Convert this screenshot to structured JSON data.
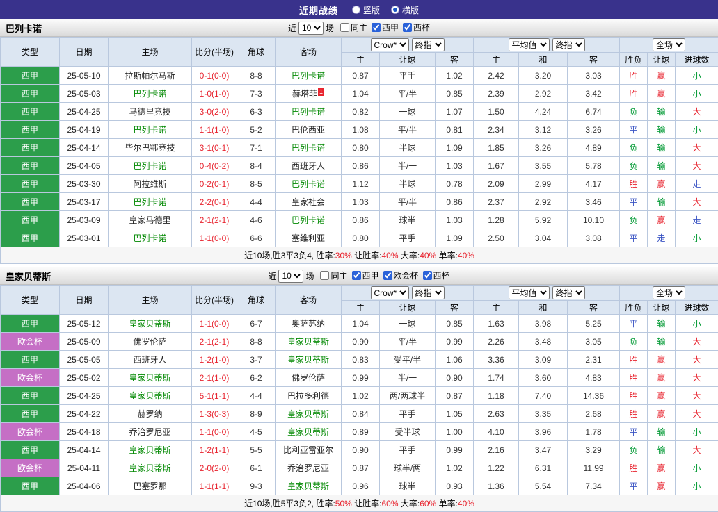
{
  "topbar": {
    "title": "近期战绩",
    "radios": [
      {
        "label": "竖版",
        "checked": false
      },
      {
        "label": "横版",
        "checked": true
      }
    ]
  },
  "table_header": {
    "type": "类型",
    "date": "日期",
    "home": "主场",
    "score": "比分(半场)",
    "corner": "角球",
    "away": "客场",
    "odds_cols": {
      "home": "主",
      "handicap": "让球",
      "away": "客"
    },
    "avg_cols": {
      "home": "主",
      "draw": "和",
      "away": "客"
    },
    "result_cols": {
      "wdl": "胜负",
      "handicap": "让球",
      "goals": "进球数"
    }
  },
  "colors": {
    "topbar_bg": "#39328c",
    "league_liga_green": "#2c9e4b",
    "league_cup_purple": "#c56fc5",
    "win_red": "#e8242f",
    "lose_green": "#009933",
    "draw_blue": "#3b55c4",
    "focus_team_green": "#008800",
    "table_header_bg": "#dce6f2"
  },
  "sections": [
    {
      "team": "巴列卡诺",
      "filters": {
        "near": "近",
        "count": "10",
        "games": "场",
        "checkboxes": [
          {
            "label": "同主",
            "checked": false
          },
          {
            "label": "西甲",
            "checked": true
          },
          {
            "label": "西杯",
            "checked": true
          }
        ]
      },
      "selects": {
        "company": "Crow*",
        "final1": "终指",
        "average": "平均值",
        "final2": "终指",
        "scope": "全场"
      },
      "rows": [
        {
          "league": "西甲",
          "cup": false,
          "date": "25-05-10",
          "home": "拉斯帕尔马斯",
          "home_focus": false,
          "score": "0-1(0-0)",
          "corner": "8-8",
          "away": "巴列卡诺",
          "away_focus": true,
          "odds": [
            "0.87",
            "平手",
            "1.02"
          ],
          "avg": [
            "2.42",
            "3.20",
            "3.03"
          ],
          "result": [
            {
              "t": "胜",
              "c": "red"
            },
            {
              "t": "赢",
              "c": "red"
            },
            {
              "t": "小",
              "c": "green"
            }
          ]
        },
        {
          "league": "西甲",
          "cup": false,
          "date": "25-05-03",
          "home": "巴列卡诺",
          "home_focus": true,
          "score": "1-0(1-0)",
          "corner": "7-3",
          "away": "赫塔菲",
          "away_focus": false,
          "away_badge": "1",
          "odds": [
            "1.04",
            "平/半",
            "0.85"
          ],
          "avg": [
            "2.39",
            "2.92",
            "3.42"
          ],
          "result": [
            {
              "t": "胜",
              "c": "red"
            },
            {
              "t": "赢",
              "c": "red"
            },
            {
              "t": "小",
              "c": "green"
            }
          ]
        },
        {
          "league": "西甲",
          "cup": false,
          "date": "25-04-25",
          "home": "马德里竞技",
          "home_focus": false,
          "score": "3-0(2-0)",
          "corner": "6-3",
          "away": "巴列卡诺",
          "away_focus": true,
          "odds": [
            "0.82",
            "一球",
            "1.07"
          ],
          "avg": [
            "1.50",
            "4.24",
            "6.74"
          ],
          "result": [
            {
              "t": "负",
              "c": "green"
            },
            {
              "t": "输",
              "c": "green"
            },
            {
              "t": "大",
              "c": "red"
            }
          ]
        },
        {
          "league": "西甲",
          "cup": false,
          "date": "25-04-19",
          "home": "巴列卡诺",
          "home_focus": true,
          "score": "1-1(1-0)",
          "corner": "5-2",
          "away": "巴伦西亚",
          "away_focus": false,
          "odds": [
            "1.08",
            "平/半",
            "0.81"
          ],
          "avg": [
            "2.34",
            "3.12",
            "3.26"
          ],
          "result": [
            {
              "t": "平",
              "c": "blue"
            },
            {
              "t": "输",
              "c": "green"
            },
            {
              "t": "小",
              "c": "green"
            }
          ]
        },
        {
          "league": "西甲",
          "cup": false,
          "date": "25-04-14",
          "home": "毕尔巴鄂竞技",
          "home_focus": false,
          "score": "3-1(0-1)",
          "corner": "7-1",
          "away": "巴列卡诺",
          "away_focus": true,
          "odds": [
            "0.80",
            "半球",
            "1.09"
          ],
          "avg": [
            "1.85",
            "3.26",
            "4.89"
          ],
          "result": [
            {
              "t": "负",
              "c": "green"
            },
            {
              "t": "输",
              "c": "green"
            },
            {
              "t": "大",
              "c": "red"
            }
          ]
        },
        {
          "league": "西甲",
          "cup": false,
          "date": "25-04-05",
          "home": "巴列卡诺",
          "home_focus": true,
          "score": "0-4(0-2)",
          "corner": "8-4",
          "away": "西班牙人",
          "away_focus": false,
          "odds": [
            "0.86",
            "半/一",
            "1.03"
          ],
          "avg": [
            "1.67",
            "3.55",
            "5.78"
          ],
          "result": [
            {
              "t": "负",
              "c": "green"
            },
            {
              "t": "输",
              "c": "green"
            },
            {
              "t": "大",
              "c": "red"
            }
          ]
        },
        {
          "league": "西甲",
          "cup": false,
          "date": "25-03-30",
          "home": "阿拉维斯",
          "home_focus": false,
          "score": "0-2(0-1)",
          "corner": "8-5",
          "away": "巴列卡诺",
          "away_focus": true,
          "odds": [
            "1.12",
            "半球",
            "0.78"
          ],
          "avg": [
            "2.09",
            "2.99",
            "4.17"
          ],
          "result": [
            {
              "t": "胜",
              "c": "red"
            },
            {
              "t": "赢",
              "c": "red"
            },
            {
              "t": "走",
              "c": "blue"
            }
          ]
        },
        {
          "league": "西甲",
          "cup": false,
          "date": "25-03-17",
          "home": "巴列卡诺",
          "home_focus": true,
          "score": "2-2(0-1)",
          "corner": "4-4",
          "away": "皇家社会",
          "away_focus": false,
          "odds": [
            "1.03",
            "平/半",
            "0.86"
          ],
          "avg": [
            "2.37",
            "2.92",
            "3.46"
          ],
          "result": [
            {
              "t": "平",
              "c": "blue"
            },
            {
              "t": "输",
              "c": "green"
            },
            {
              "t": "大",
              "c": "red"
            }
          ]
        },
        {
          "league": "西甲",
          "cup": false,
          "date": "25-03-09",
          "home": "皇家马德里",
          "home_focus": false,
          "score": "2-1(2-1)",
          "corner": "4-6",
          "away": "巴列卡诺",
          "away_focus": true,
          "odds": [
            "0.86",
            "球半",
            "1.03"
          ],
          "avg": [
            "1.28",
            "5.92",
            "10.10"
          ],
          "result": [
            {
              "t": "负",
              "c": "green"
            },
            {
              "t": "赢",
              "c": "red"
            },
            {
              "t": "走",
              "c": "blue"
            }
          ]
        },
        {
          "league": "西甲",
          "cup": false,
          "date": "25-03-01",
          "home": "巴列卡诺",
          "home_focus": true,
          "score": "1-1(0-0)",
          "corner": "6-6",
          "away": "塞维利亚",
          "away_focus": false,
          "odds": [
            "0.80",
            "平手",
            "1.09"
          ],
          "avg": [
            "2.50",
            "3.04",
            "3.08"
          ],
          "result": [
            {
              "t": "平",
              "c": "blue"
            },
            {
              "t": "走",
              "c": "blue"
            },
            {
              "t": "小",
              "c": "green"
            }
          ]
        }
      ],
      "summary": {
        "prefix": "近10场,胜3平3负4, ",
        "stats": [
          {
            "label": "胜率:",
            "value": "30%"
          },
          {
            "label": "让胜率:",
            "value": "40%"
          },
          {
            "label": "大率:",
            "value": "40%"
          },
          {
            "label": "单率:",
            "value": "40%"
          }
        ]
      }
    },
    {
      "team": "皇家贝蒂斯",
      "filters": {
        "near": "近",
        "count": "10",
        "games": "场",
        "checkboxes": [
          {
            "label": "同主",
            "checked": false
          },
          {
            "label": "西甲",
            "checked": true
          },
          {
            "label": "欧会杯",
            "checked": true
          },
          {
            "label": "西杯",
            "checked": true
          }
        ]
      },
      "selects": {
        "company": "Crow*",
        "final1": "终指",
        "average": "平均值",
        "final2": "终指",
        "scope": "全场"
      },
      "rows": [
        {
          "league": "西甲",
          "cup": false,
          "date": "25-05-12",
          "home": "皇家贝蒂斯",
          "home_focus": true,
          "score": "1-1(0-0)",
          "corner": "6-7",
          "away": "奥萨苏纳",
          "away_focus": false,
          "odds": [
            "1.04",
            "一球",
            "0.85"
          ],
          "avg": [
            "1.63",
            "3.98",
            "5.25"
          ],
          "result": [
            {
              "t": "平",
              "c": "blue"
            },
            {
              "t": "输",
              "c": "green"
            },
            {
              "t": "小",
              "c": "green"
            }
          ]
        },
        {
          "league": "欧会杯",
          "cup": true,
          "date": "25-05-09",
          "home": "佛罗伦萨",
          "home_focus": false,
          "score": "2-1(2-1)",
          "corner": "8-8",
          "away": "皇家贝蒂斯",
          "away_focus": true,
          "odds": [
            "0.90",
            "平/半",
            "0.99"
          ],
          "avg": [
            "2.26",
            "3.48",
            "3.05"
          ],
          "result": [
            {
              "t": "负",
              "c": "green"
            },
            {
              "t": "输",
              "c": "green"
            },
            {
              "t": "大",
              "c": "red"
            }
          ]
        },
        {
          "league": "西甲",
          "cup": false,
          "date": "25-05-05",
          "home": "西班牙人",
          "home_focus": false,
          "score": "1-2(1-0)",
          "corner": "3-7",
          "away": "皇家贝蒂斯",
          "away_focus": true,
          "odds": [
            "0.83",
            "受平/半",
            "1.06"
          ],
          "avg": [
            "3.36",
            "3.09",
            "2.31"
          ],
          "result": [
            {
              "t": "胜",
              "c": "red"
            },
            {
              "t": "赢",
              "c": "red"
            },
            {
              "t": "大",
              "c": "red"
            }
          ]
        },
        {
          "league": "欧会杯",
          "cup": true,
          "date": "25-05-02",
          "home": "皇家贝蒂斯",
          "home_focus": true,
          "score": "2-1(1-0)",
          "corner": "6-2",
          "away": "佛罗伦萨",
          "away_focus": false,
          "odds": [
            "0.99",
            "半/一",
            "0.90"
          ],
          "avg": [
            "1.74",
            "3.60",
            "4.83"
          ],
          "result": [
            {
              "t": "胜",
              "c": "red"
            },
            {
              "t": "赢",
              "c": "red"
            },
            {
              "t": "大",
              "c": "red"
            }
          ]
        },
        {
          "league": "西甲",
          "cup": false,
          "date": "25-04-25",
          "home": "皇家贝蒂斯",
          "home_focus": true,
          "score": "5-1(1-1)",
          "corner": "4-4",
          "away": "巴拉多利德",
          "away_focus": false,
          "odds": [
            "1.02",
            "两/两球半",
            "0.87"
          ],
          "avg": [
            "1.18",
            "7.40",
            "14.36"
          ],
          "result": [
            {
              "t": "胜",
              "c": "red"
            },
            {
              "t": "赢",
              "c": "red"
            },
            {
              "t": "大",
              "c": "red"
            }
          ]
        },
        {
          "league": "西甲",
          "cup": false,
          "date": "25-04-22",
          "home": "赫罗纳",
          "home_focus": false,
          "score": "1-3(0-3)",
          "corner": "8-9",
          "away": "皇家贝蒂斯",
          "away_focus": true,
          "odds": [
            "0.84",
            "平手",
            "1.05"
          ],
          "avg": [
            "2.63",
            "3.35",
            "2.68"
          ],
          "result": [
            {
              "t": "胜",
              "c": "red"
            },
            {
              "t": "赢",
              "c": "red"
            },
            {
              "t": "大",
              "c": "red"
            }
          ]
        },
        {
          "league": "欧会杯",
          "cup": true,
          "date": "25-04-18",
          "home": "乔治罗尼亚",
          "home_focus": false,
          "score": "1-1(0-0)",
          "corner": "4-5",
          "away": "皇家贝蒂斯",
          "away_focus": true,
          "odds": [
            "0.89",
            "受半球",
            "1.00"
          ],
          "avg": [
            "4.10",
            "3.96",
            "1.78"
          ],
          "result": [
            {
              "t": "平",
              "c": "blue"
            },
            {
              "t": "输",
              "c": "green"
            },
            {
              "t": "小",
              "c": "green"
            }
          ]
        },
        {
          "league": "西甲",
          "cup": false,
          "date": "25-04-14",
          "home": "皇家贝蒂斯",
          "home_focus": true,
          "score": "1-2(1-1)",
          "corner": "5-5",
          "away": "比利亚雷亚尔",
          "away_focus": false,
          "odds": [
            "0.90",
            "平手",
            "0.99"
          ],
          "avg": [
            "2.16",
            "3.47",
            "3.29"
          ],
          "result": [
            {
              "t": "负",
              "c": "green"
            },
            {
              "t": "输",
              "c": "green"
            },
            {
              "t": "大",
              "c": "red"
            }
          ]
        },
        {
          "league": "欧会杯",
          "cup": true,
          "date": "25-04-11",
          "home": "皇家贝蒂斯",
          "home_focus": true,
          "score": "2-0(2-0)",
          "corner": "6-1",
          "away": "乔治罗尼亚",
          "away_focus": false,
          "odds": [
            "0.87",
            "球半/两",
            "1.02"
          ],
          "avg": [
            "1.22",
            "6.31",
            "11.99"
          ],
          "result": [
            {
              "t": "胜",
              "c": "red"
            },
            {
              "t": "赢",
              "c": "red"
            },
            {
              "t": "小",
              "c": "green"
            }
          ]
        },
        {
          "league": "西甲",
          "cup": false,
          "date": "25-04-06",
          "home": "巴塞罗那",
          "home_focus": false,
          "score": "1-1(1-1)",
          "corner": "9-3",
          "away": "皇家贝蒂斯",
          "away_focus": true,
          "odds": [
            "0.96",
            "球半",
            "0.93"
          ],
          "avg": [
            "1.36",
            "5.54",
            "7.34"
          ],
          "result": [
            {
              "t": "平",
              "c": "blue"
            },
            {
              "t": "赢",
              "c": "red"
            },
            {
              "t": "小",
              "c": "green"
            }
          ]
        }
      ],
      "summary": {
        "prefix": "近10场,胜5平3负2, ",
        "stats": [
          {
            "label": "胜率:",
            "value": "50%"
          },
          {
            "label": "让胜率:",
            "value": "60%"
          },
          {
            "label": "大率:",
            "value": "60%"
          },
          {
            "label": "单率:",
            "value": "40%"
          }
        ]
      }
    }
  ]
}
